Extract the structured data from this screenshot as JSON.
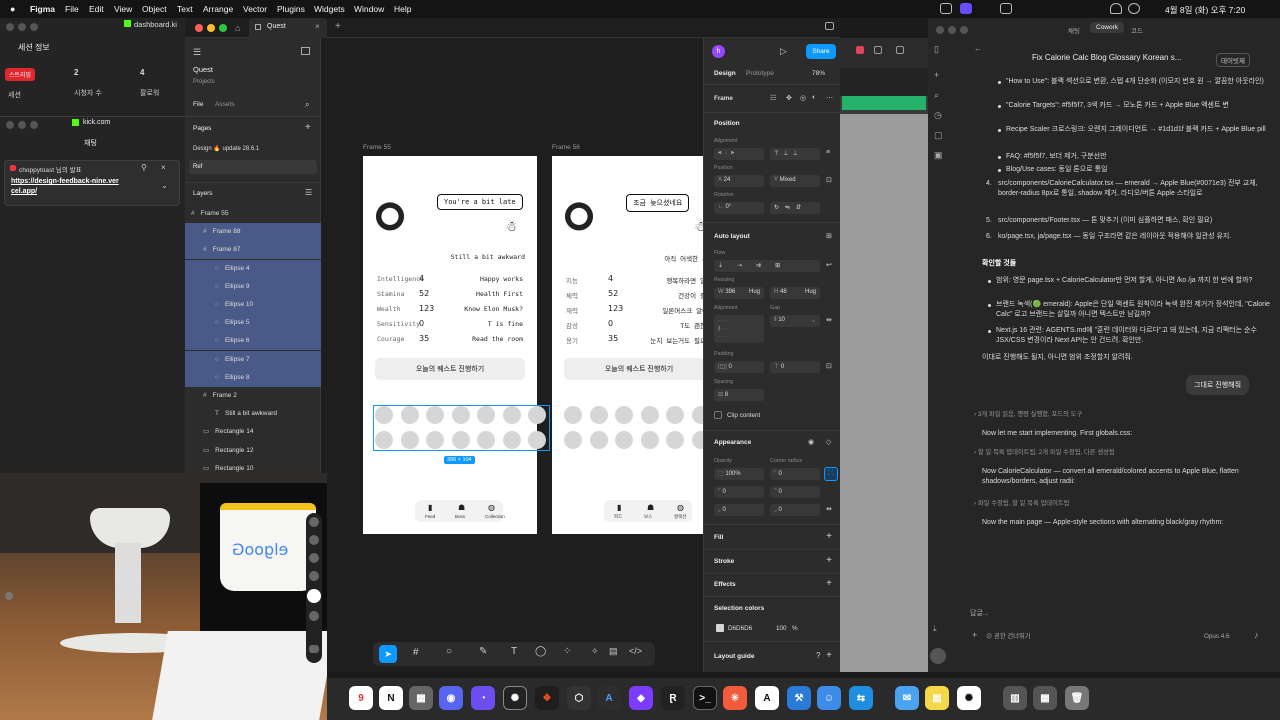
{
  "menubar": {
    "app": "Figma",
    "items": [
      "File",
      "Edit",
      "View",
      "Object",
      "Text",
      "Arrange",
      "Vector",
      "Plugins",
      "Widgets",
      "Window",
      "Help"
    ],
    "clock": "4월 8일 (화) 오후 7:20"
  },
  "left": {
    "session": {
      "title": "세션 정보",
      "live_badge": "스트리밍",
      "session_label": "세션",
      "viewers_count": "2",
      "viewers_label": "시청자 수",
      "followers_count": "4",
      "followers_label": "팔로워"
    },
    "kick": {
      "url": "kick.com",
      "title": "채팅",
      "user": "choppytoast 님의 발표",
      "link": "https://design-feedback-nine.vercel.app/"
    }
  },
  "figma": {
    "tabs": {
      "tab1": "dashboard.ki",
      "tab2": "Quest"
    },
    "file": {
      "name": "Quest",
      "sub": "Projects"
    },
    "panel_tabs": {
      "file": "File",
      "assets": "Assets"
    },
    "pages_title": "Pages",
    "pages": [
      "Design 🔥 update 28.6.1",
      "Ref"
    ],
    "layers_title": "Layers",
    "layers": [
      {
        "label": "Frame 55",
        "indent": 0,
        "sel": false
      },
      {
        "label": "Frame 88",
        "indent": 1,
        "sel": true
      },
      {
        "label": "Frame 87",
        "indent": 1,
        "sel": true
      },
      {
        "label": "Ellipse 4",
        "indent": 2,
        "sel": true
      },
      {
        "label": "Ellipse 9",
        "indent": 2,
        "sel": true
      },
      {
        "label": "Ellipse 10",
        "indent": 2,
        "sel": true
      },
      {
        "label": "Ellipse 5",
        "indent": 2,
        "sel": true
      },
      {
        "label": "Ellipse 6",
        "indent": 2,
        "sel": true
      },
      {
        "label": "Ellipse 7",
        "indent": 2,
        "sel": true
      },
      {
        "label": "Ellipse 8",
        "indent": 2,
        "sel": true
      },
      {
        "label": "Frame 2",
        "indent": 1,
        "sel": false
      },
      {
        "label": "Still a bit awkward",
        "indent": 2,
        "sel": false
      },
      {
        "label": "Rectangle 14",
        "indent": 1,
        "sel": false
      },
      {
        "label": "Rectangle 12",
        "indent": 1,
        "sel": false
      },
      {
        "label": "Rectangle 10",
        "indent": 1,
        "sel": false
      }
    ],
    "frames": [
      {
        "name": "Frame 55",
        "bubble": "You're a bit late",
        "caption": "Still a bit awkward",
        "stats": [
          [
            "Intelligence",
            "4",
            "Happy works"
          ],
          [
            "Stamina",
            "52",
            "Health First"
          ],
          [
            "Wealth",
            "123",
            "Know Elon Musk?"
          ],
          [
            "Sensitivity",
            "0",
            "T is fine"
          ],
          [
            "Courage",
            "35",
            "Read the room"
          ]
        ],
        "quest": "오늘의 퀘스트 진행하기",
        "nav": [
          "Feed",
          "Boss",
          "Collection"
        ]
      },
      {
        "name": "Frame 56",
        "bubble": "조금 늦으셨네요",
        "caption": "아직 어색한 사이",
        "stats": [
          [
            "지능",
            "4",
            "행복하라면 일해"
          ],
          [
            "체력",
            "52",
            "건강이 중요"
          ],
          [
            "재력",
            "123",
            "일론머스크 알아?"
          ],
          [
            "감성",
            "0",
            "T도 괜찮아"
          ],
          [
            "용기",
            "35",
            "눈치 보는거도 필요해"
          ]
        ],
        "quest": "오늘의 퀘스트 진행하기",
        "nav": [
          "피드",
          "보스",
          "컬렉션"
        ]
      }
    ],
    "selection_size": "396 × 104",
    "props": {
      "user": "h",
      "share": "Share",
      "tab_design": "Design",
      "tab_prototype": "Prototype",
      "zoom": "78%",
      "frame_label": "Frame",
      "position": "Position",
      "alignment": "Alignment",
      "position_label": "Position",
      "x": "24",
      "y": "Mixed",
      "rotation_label": "Rotation",
      "rotation": "0°",
      "auto_layout": "Auto layout",
      "flow": "Flow",
      "resizing": "Resizing",
      "w": "396",
      "w_mode": "Hug",
      "h": "48",
      "h_mode": "Hug",
      "alignment2": "Alignment",
      "gap_label": "Gap",
      "gap": "10",
      "padding": "Padding",
      "pad_h": "0",
      "pad_v": "0",
      "spacing": "Spacing",
      "spacing_val": "8",
      "clip": "Clip content",
      "appearance": "Appearance",
      "opacity_label": "Opacity",
      "radius_label": "Corner radius",
      "opacity": "100%",
      "radius": "0",
      "r1": "0",
      "r2": "0",
      "r3": "0",
      "r4": "0",
      "fill": "Fill",
      "stroke": "Stroke",
      "effects": "Effects",
      "selection_colors": "Selection colors",
      "color_hex": "D6D6D6",
      "color_pct": "100",
      "color_unit": "%",
      "layout_guide": "Layout guide"
    }
  },
  "chat": {
    "header_tabs": [
      "채팅",
      "Cowork",
      "코드"
    ],
    "title": "Fix Calorie Calc Blog Glossary Korean s...",
    "badge": "데이빗제",
    "bullets": [
      "\"How to Use\": 블랙 섹션으로 변환, 스텝 4개 단순화 (이모지 번호 원 → 깔끔한 아웃라인)",
      "\"Calorie Targets\": #f5f5f7, 3색 카드 → 모노톤 카드 + Apple Blue 액센트 변",
      "Recipe Scaler 크로스링크: 오렌지 그레이디언트 → #1d1d1f 블랙 카드 + Apple Blue pill",
      "FAQ: #f5f5f7, 보더 제거, 구분선만",
      "Blog/Use cases: 동일 톤으로 통일"
    ],
    "n4": "src/components/CalorieCalculator.tsx — emerald → Apple Blue(#0071e3) 전부 교체, border-radius 8px로 통일, shadow 제거, 라디오/버튼 Apple 스타일로",
    "n5": "src/components/Footer.tsx — 톤 맞추기 (이미 심플하면 패스, 확인 필요)",
    "n6": "ko/page.tsx, ja/page.tsx — 동일 구조라면 같은 레이아웃 적용해야 일관성 유지.",
    "check_title": "확인할 것들",
    "checks": [
      "범위: 영문 page.tsx + CalorieCalculator만 먼저 할게, 아니면 /ko /ja 까지 한 번에 할까?",
      "브랜드 녹색(🟢 emerald): Apple은 단일 액센트 원칙이라 녹색 완전 제거가 정석인데, \"Calorie Calc\" 로고 브랜드는 살릴까 아니면 텍스트만 남길까?",
      "Next.js 16 관련: AGENTS.md에 \"훈련 데이터와 다르다\"고 돼 있는데, 지금 리팩터는 순수 JSX/CSS 변경이라 Next API는 안 건드려. 확인만."
    ],
    "closing": "이대로 진행해도 될지, 아니면 범위 조정할지 알려줘.",
    "user_msg": "그대로 진행해줘",
    "collapsed1": "3개 파일 읽음, 명령 실행함, 포드의 도구",
    "msg1": "Now let me start implementing. First globals.css:",
    "collapsed2": "할 일 목록 업데이트됨, 2개 파일 수정됨, 다른 생성됨",
    "msg2": "Now CalorieCalculator — convert all emerald/colored accents to Apple Blue, flatten shadows/borders, adjust radii:",
    "collapsed3": "파일 수정됨, 할 일 목록 업데이트됨",
    "msg3": "Now the main page — Apple-style sections with alternating black/gray rhythm:",
    "thinking": "답글...",
    "permission": "권한 건너뛰기",
    "model": "Opus 4.6"
  },
  "colors": {
    "accent": "#0d99ff",
    "selection": "#4a5a88",
    "chat_bg": "#262626",
    "figma_panel": "#2c2c2c"
  }
}
